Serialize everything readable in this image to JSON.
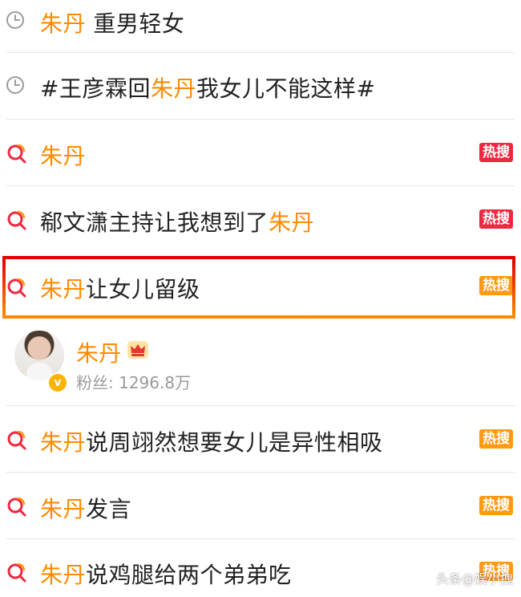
{
  "suggestions": [
    {
      "type": "history",
      "prefix": "",
      "highlight": "朱丹",
      "suffix": " 重男轻女"
    },
    {
      "type": "history",
      "prefix": "#王彦霖回",
      "highlight": "朱丹",
      "suffix": "我女儿不能这样#"
    },
    {
      "type": "hot",
      "prefix": "",
      "highlight": "朱丹",
      "suffix": "",
      "badge": "热搜",
      "badge_color": "#ee2841"
    },
    {
      "type": "hot",
      "prefix": "郗文潇主持让我想到了",
      "highlight": "朱丹",
      "suffix": "",
      "badge": "热搜",
      "badge_color": "#ee2841"
    },
    {
      "type": "hot",
      "prefix": "",
      "highlight": "朱丹",
      "suffix": "让女儿留级",
      "badge": "热搜",
      "badge_color": "#ff9a12"
    },
    {
      "type": "hot",
      "prefix": "",
      "highlight": "朱丹",
      "suffix": "说周翊然想要女儿是异性相吸",
      "badge": "热搜",
      "badge_color": "#ff9a12"
    },
    {
      "type": "hot",
      "prefix": "",
      "highlight": "朱丹",
      "suffix": "发言",
      "badge": "热搜",
      "badge_color": "#ff9a12"
    },
    {
      "type": "hot",
      "prefix": "",
      "highlight": "朱丹",
      "suffix": "说鸡腿给两个弟弟吃",
      "badge": "热搜",
      "badge_color": "#ff9a12"
    }
  ],
  "profile": {
    "name": "朱丹",
    "fans_label": "粉丝: 1296.8万",
    "verified_label": "v"
  },
  "watermark": "头条@娱小拽",
  "colors": {
    "highlight": "#ff8a00",
    "badge_red": "#ee2841",
    "badge_orange": "#ff9a12"
  }
}
